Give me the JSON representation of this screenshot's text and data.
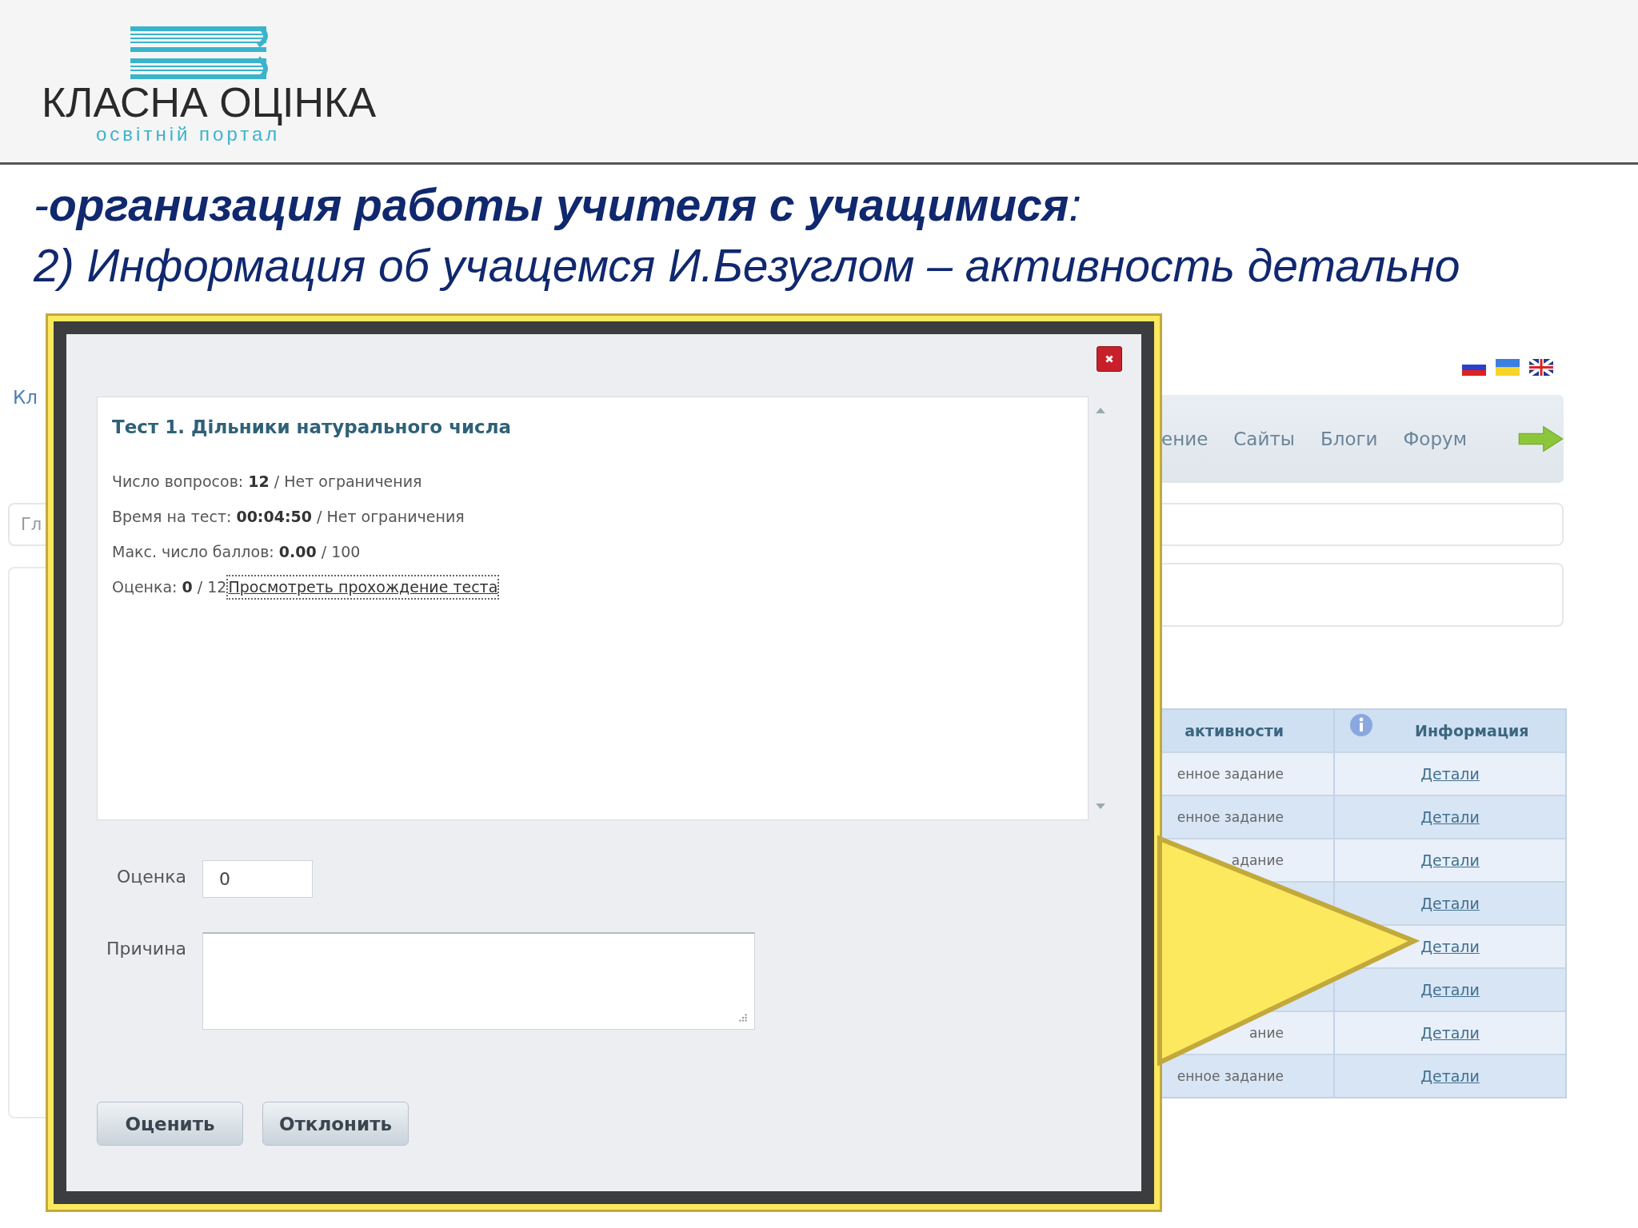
{
  "header": {
    "logo_title": "КЛАСНА ОЦІНКА",
    "logo_subtitle": "освітній портал"
  },
  "heading": [
    "-**организация работы учителя с учащимися**:",
    "2) Информация об учащемся И.Безуглом – активность детально"
  ],
  "background_page": {
    "brand_fragment": "Кл",
    "search_fragment": "Гл",
    "nav": [
      "ение",
      "Сайты",
      "Блоги",
      "Форум"
    ],
    "table": {
      "columns": [
        "активности",
        "Информация"
      ],
      "rows": [
        {
          "activity": "енное задание",
          "info": "Детали"
        },
        {
          "activity": "енное задание",
          "info": "Детали"
        },
        {
          "activity": "адание",
          "info": "Детали"
        },
        {
          "info": "Детали"
        },
        {
          "info": "Детали"
        },
        {
          "info": "Детали"
        },
        {
          "activity": "ание",
          "info": "Детали"
        },
        {
          "activity": "енное задание",
          "info": "Детали"
        }
      ]
    }
  },
  "dialog": {
    "title": "Тест 1. Дільники натурального числа",
    "lines": [
      "Число вопросов: **12** / Нет ограничения",
      "Время на тест: **00:04:50** / Нет ограничения",
      "Макс. число баллов: **0.00** / 100"
    ],
    "grade_line": "Оценка: **0** / 12",
    "grade_link": "Просмотреть прохождение теста",
    "score_label": "Оценка",
    "score_value": "0",
    "reason_label": "Причина",
    "buttons": [
      "Оценить",
      "Отклонить"
    ]
  }
}
